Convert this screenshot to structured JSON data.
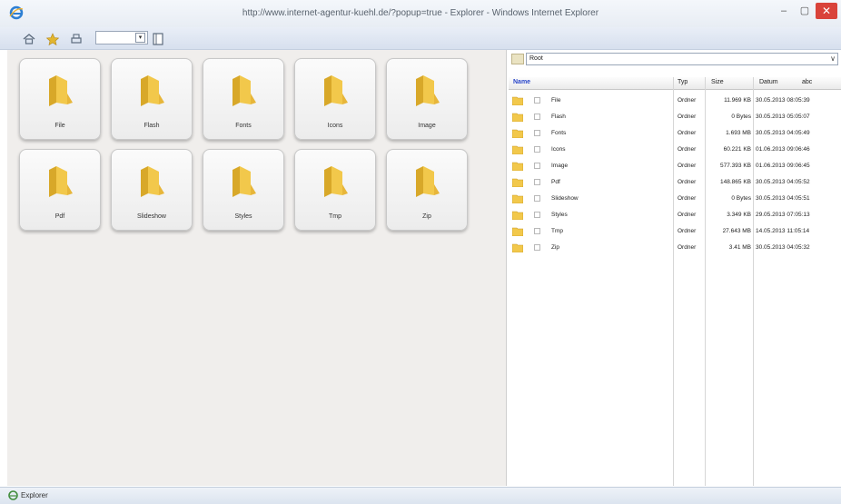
{
  "window": {
    "title": "http://www.internet-agentur-kuehl.de/?popup=true - Explorer - Windows Internet Explorer",
    "minimize": "–",
    "maximize": "▢",
    "close": "✕"
  },
  "toolbar": {
    "zoom_value": "",
    "zoom_arrow": "▾"
  },
  "tiles": [
    {
      "label": "File"
    },
    {
      "label": "Flash"
    },
    {
      "label": "Fonts"
    },
    {
      "label": "Icons"
    },
    {
      "label": "Image"
    },
    {
      "label": "Pdf"
    },
    {
      "label": "Slideshow"
    },
    {
      "label": "Styles"
    },
    {
      "label": "Tmp"
    },
    {
      "label": "Zip"
    }
  ],
  "path": {
    "value": "Root",
    "arrow": "∨"
  },
  "columns": {
    "name": "Name",
    "typ": "Typ",
    "size": "Size",
    "date": "Datum",
    "sort": "abc"
  },
  "files": [
    {
      "name": "File",
      "typ": "Ordner",
      "size": "11.969 KB",
      "date": "30.05.2013 08:05:39"
    },
    {
      "name": "Flash",
      "typ": "Ordner",
      "size": "0 Bytes",
      "date": "30.05.2013 05:05:07"
    },
    {
      "name": "Fonts",
      "typ": "Ordner",
      "size": "1.693 MB",
      "date": "30.05.2013 04:05:49"
    },
    {
      "name": "Icons",
      "typ": "Ordner",
      "size": "60.221 KB",
      "date": "01.06.2013 09:06:46"
    },
    {
      "name": "Image",
      "typ": "Ordner",
      "size": "577.393 KB",
      "date": "01.06.2013 09:06:45"
    },
    {
      "name": "Pdf",
      "typ": "Ordner",
      "size": "148.865 KB",
      "date": "30.05.2013 04:05:52"
    },
    {
      "name": "Slideshow",
      "typ": "Ordner",
      "size": "0 Bytes",
      "date": "30.05.2013 04:05:51"
    },
    {
      "name": "Styles",
      "typ": "Ordner",
      "size": "3.349 KB",
      "date": "29.05.2013 07:05:13"
    },
    {
      "name": "Tmp",
      "typ": "Ordner",
      "size": "27.643 MB",
      "date": "14.05.2013 11:05:14"
    },
    {
      "name": "Zip",
      "typ": "Ordner",
      "size": "3.41 MB",
      "date": "30.05.2013 04:05:32"
    }
  ],
  "status": {
    "text": "Explorer"
  },
  "colors": {
    "folder": "#f2c84b",
    "close_button": "#d9433a",
    "name_header": "#2946c9"
  }
}
